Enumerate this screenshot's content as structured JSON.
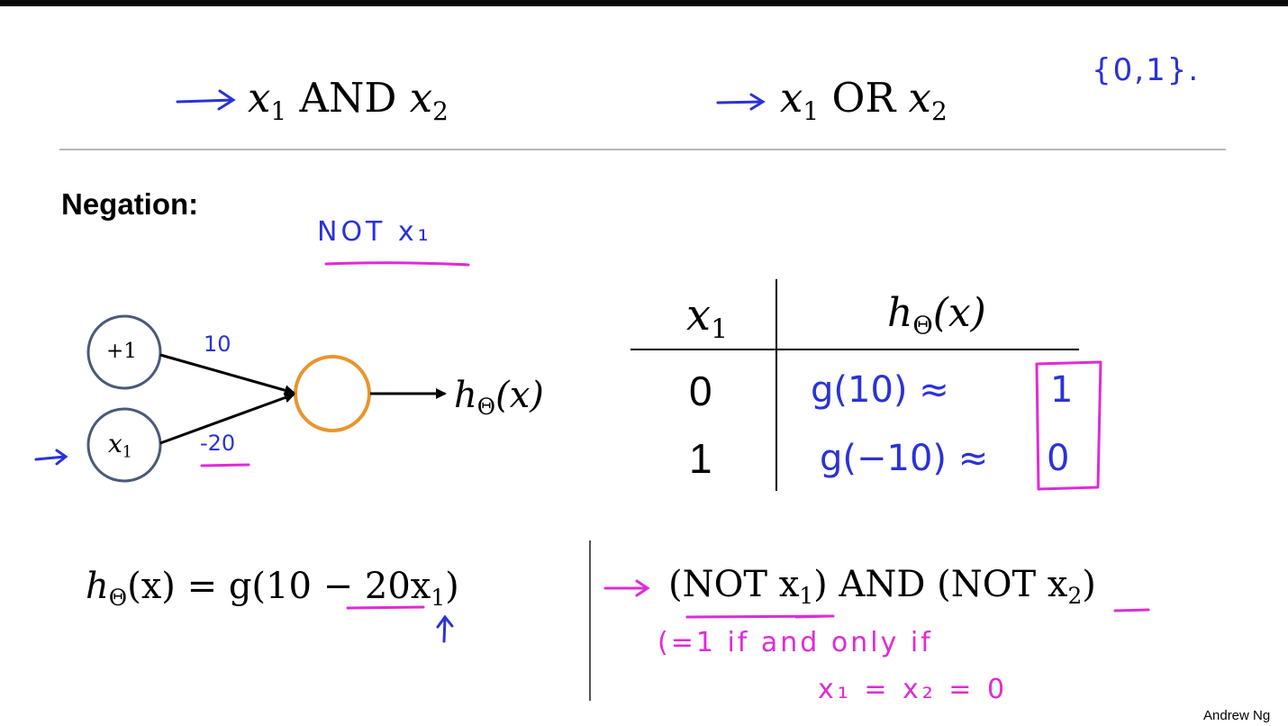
{
  "top": {
    "and_expr": {
      "x": "x",
      "sub1": "1",
      "op": "AND",
      "x2": "x",
      "sub2": "2"
    },
    "or_expr": {
      "x": "x",
      "sub1": "1",
      "op": "OR",
      "x2": "x",
      "sub2": "2"
    },
    "set_note": "{0,1}."
  },
  "section": {
    "heading": "Negation:",
    "note": "NOT x₁"
  },
  "network": {
    "bias_label": "+1",
    "input_label": "x",
    "input_sub": "1",
    "weight_bias": "10",
    "weight_input": "-20",
    "output_label": "h",
    "output_sub": "Θ",
    "output_arg": "(x)"
  },
  "truth_table": {
    "col1": {
      "sym": "x",
      "sub": "1"
    },
    "col2": {
      "sym": "h",
      "sub": "Θ",
      "arg": "(x)"
    },
    "rows": [
      {
        "x1": "0",
        "expr": "g(10) ≈",
        "result": "1"
      },
      {
        "x1": "1",
        "expr": "g(−10) ≈",
        "result": "0"
      }
    ]
  },
  "formula": {
    "lhs": "h",
    "lhs_sub": "Θ",
    "lhs_arg": "(x) = g(10 − 20x",
    "x_sub": "1",
    "close": ")"
  },
  "right_expr": {
    "p1": "(NOT x",
    "s1": "1",
    "p2": ") AND (NOT x",
    "s2": "2",
    "p3": ")",
    "note1": "(=1   if and only if",
    "note2": "x₁ = x₂ = 0"
  },
  "author": "Andrew Ng",
  "colors": {
    "blue_ink": "#2a32d8",
    "pink_ink": "#e02ad6",
    "bias_node": "#4a5a78",
    "output_node": "#e8952f"
  }
}
